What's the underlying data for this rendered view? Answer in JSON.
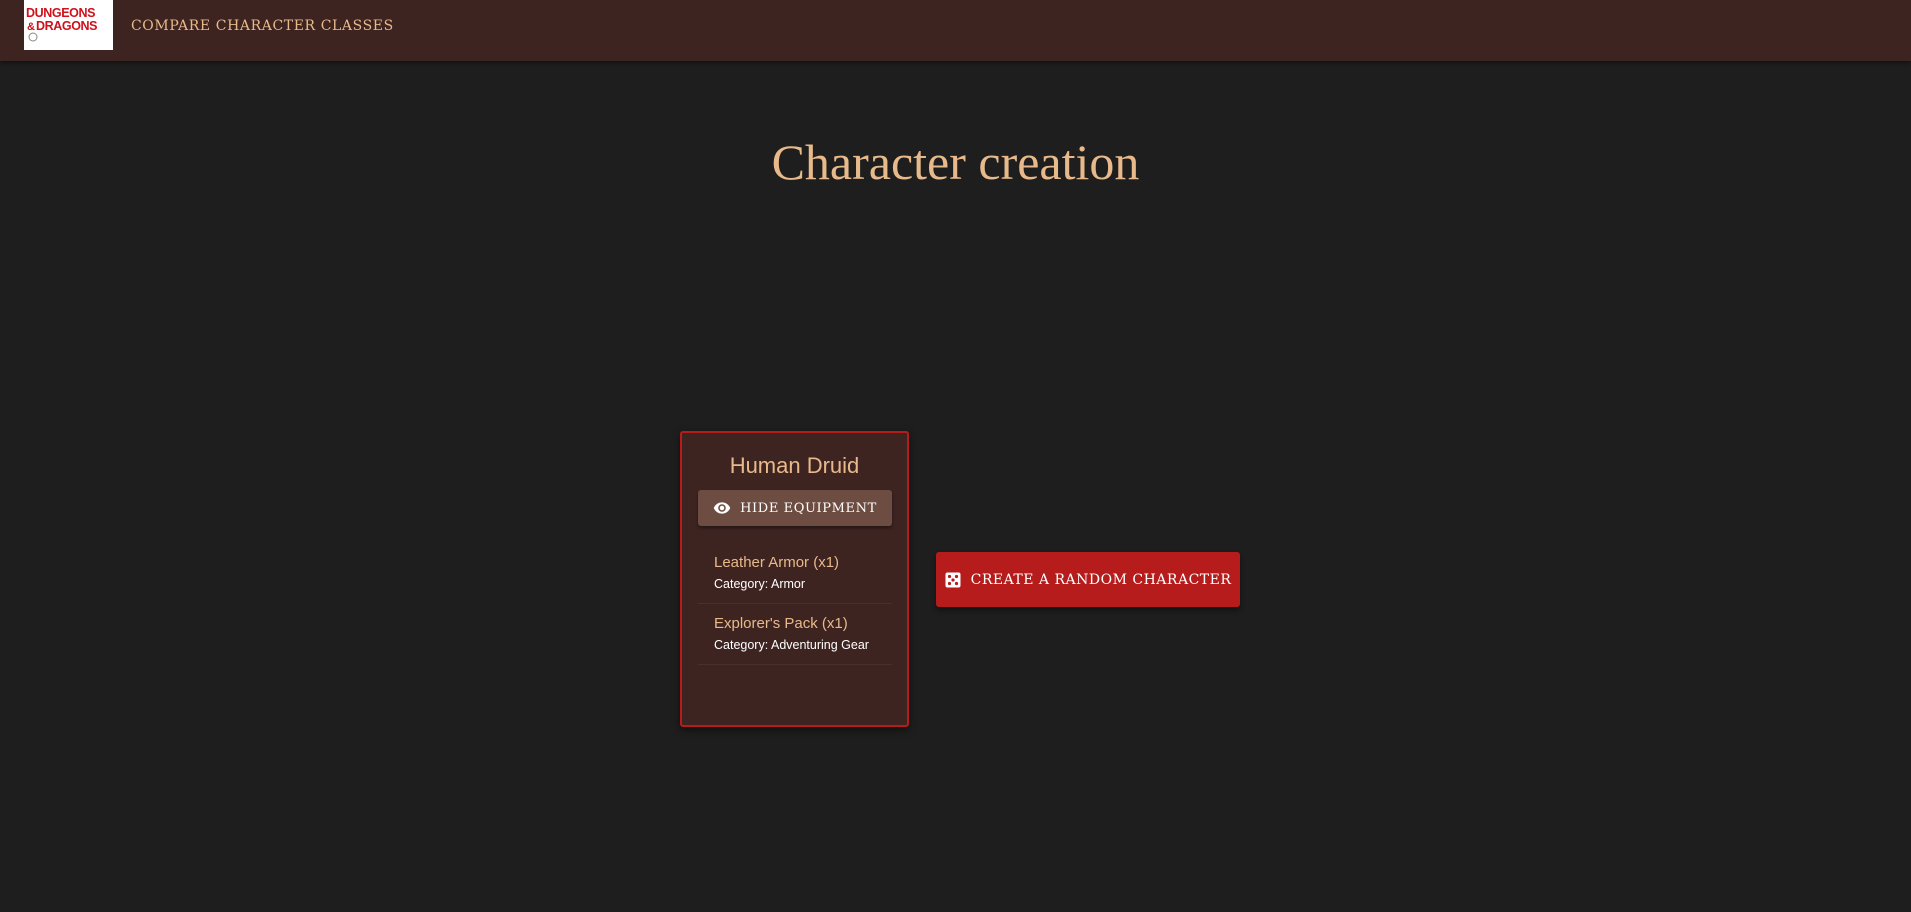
{
  "header": {
    "logo_text": "DUNGEONS & DRAGONS",
    "nav_link": "Compare character classes"
  },
  "main": {
    "title": "Character creation"
  },
  "character_card": {
    "name": "Human Druid",
    "toggle_label": "Hide equipment",
    "toggle_icon": "eye-icon",
    "equipment": [
      {
        "name": "Leather Armor (x1)",
        "category": "Category: Armor"
      },
      {
        "name": "Explorer's Pack (x1)",
        "category": "Category: Adventuring Gear"
      }
    ]
  },
  "random_button": {
    "label": "Create a random character",
    "icon": "dice-icon"
  },
  "colors": {
    "background": "#1e1e1e",
    "header": "#3d2421",
    "accent_gold": "#e8b98a",
    "card_border": "#b71c1c",
    "primary_red": "#b71c1c",
    "toggle_button": "#6d4c41"
  }
}
